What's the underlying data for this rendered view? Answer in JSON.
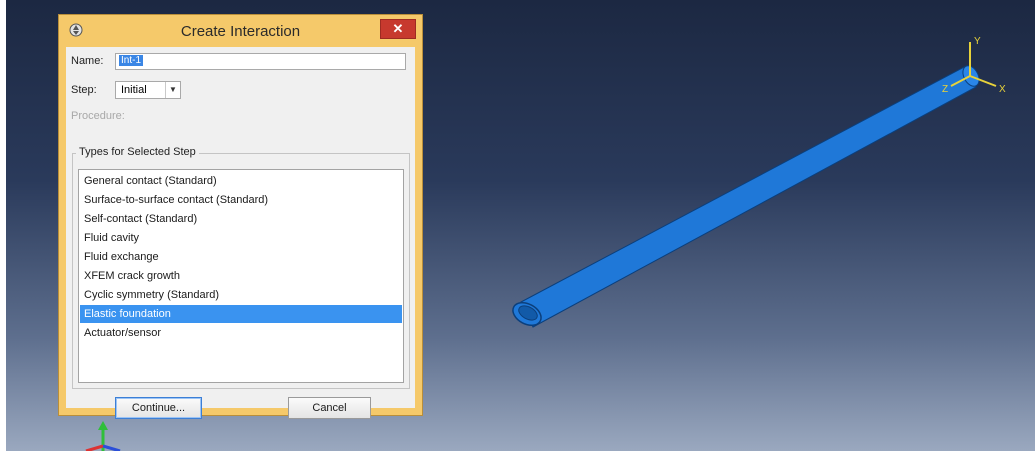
{
  "dialog": {
    "title": "Create Interaction",
    "close_label": "✕",
    "name_label": "Name:",
    "name_value": "Int-1",
    "step_label": "Step:",
    "step_value": "Initial",
    "procedure_label": "Procedure:",
    "types_group_label": "Types for Selected Step",
    "types": [
      "General contact (Standard)",
      "Surface-to-surface contact (Standard)",
      "Self-contact (Standard)",
      "Fluid cavity",
      "Fluid exchange",
      "XFEM crack growth",
      "Cyclic symmetry (Standard)",
      "Elastic foundation",
      "Actuator/sensor"
    ],
    "selected_type": "Elastic foundation",
    "continue_label": "Continue...",
    "cancel_label": "Cancel"
  },
  "viewport": {
    "triad_labels": {
      "y": "Y",
      "x": "X",
      "z": "Z"
    },
    "part_color": "#1f78d8",
    "background_top": "#1c2842",
    "background_bottom": "#9aa8bf"
  }
}
